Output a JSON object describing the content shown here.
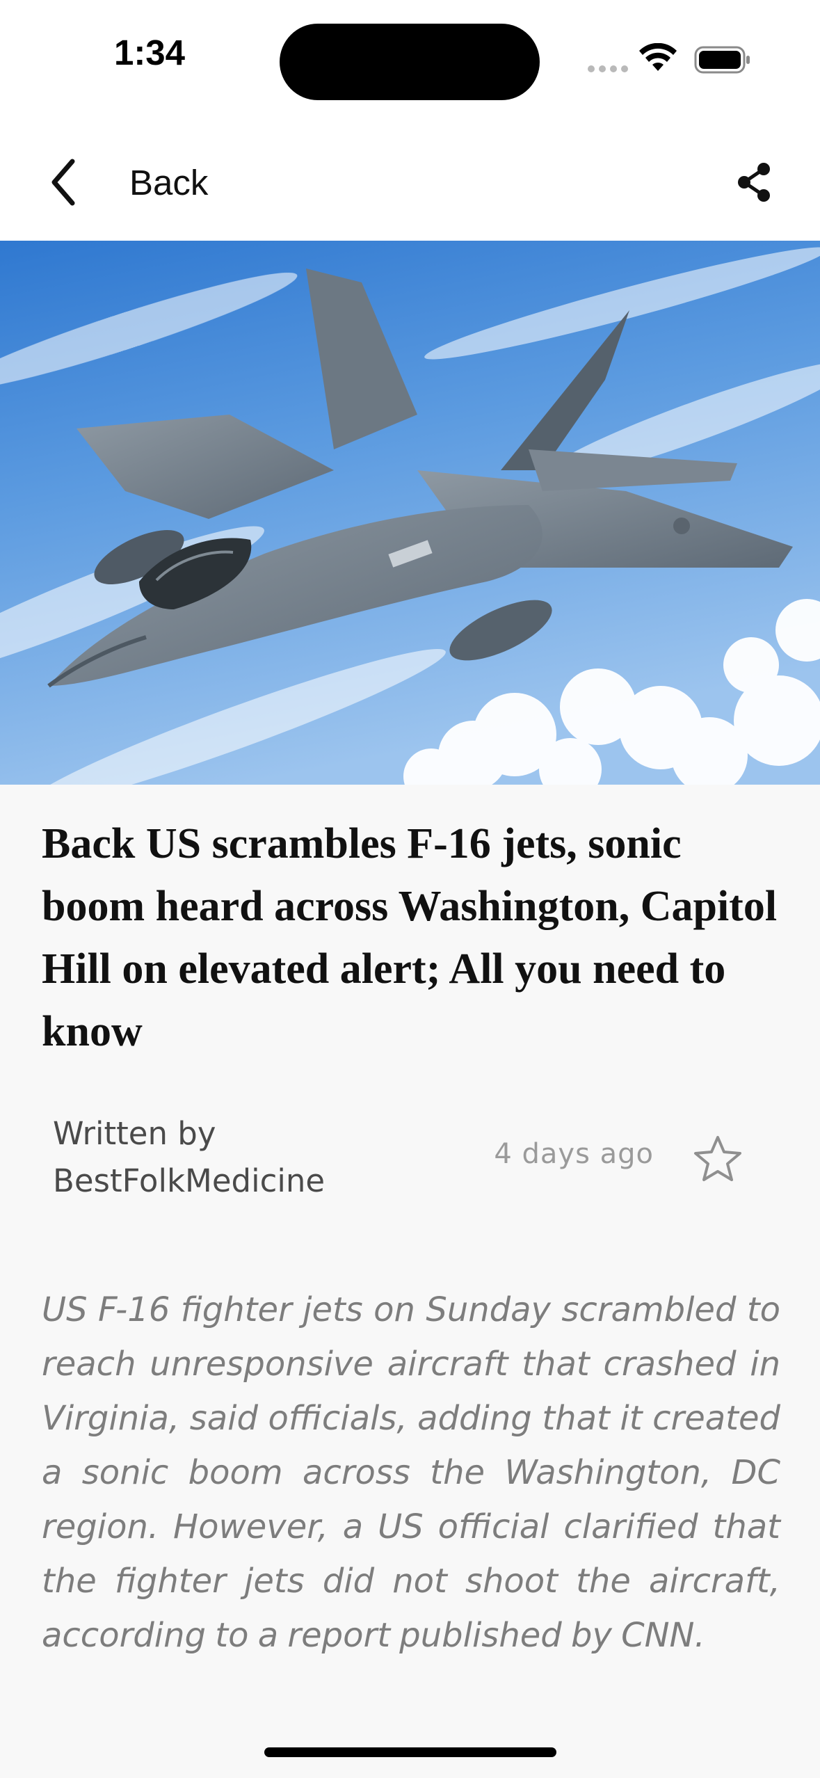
{
  "status_bar": {
    "time": "1:34"
  },
  "nav": {
    "back_label": "Back",
    "back_icon": "chevron-left-icon",
    "share_icon": "share-icon"
  },
  "hero": {
    "image_subject": "fighter jet flying above clouds",
    "sky_color": "#3f86d8",
    "jet_color": "#7d8893"
  },
  "article": {
    "title": "Back US scrambles F-16 jets, sonic boom heard across Washington, Capitol Hill on elevated alert; All you need to know",
    "byline_prefix": "Written by",
    "author": "BestFolkMedicine",
    "time_ago": "4 days ago",
    "bookmark_icon": "star-outline-icon",
    "summary": "US F-16 fighter jets on Sunday scrambled to reach unresponsive aircraft that crashed in Virginia, said officials, adding that it created a sonic boom across the Washington, DC region. However, a US official clarified that the fighter jets did not shoot the aircraft, according to a report published by CNN."
  }
}
